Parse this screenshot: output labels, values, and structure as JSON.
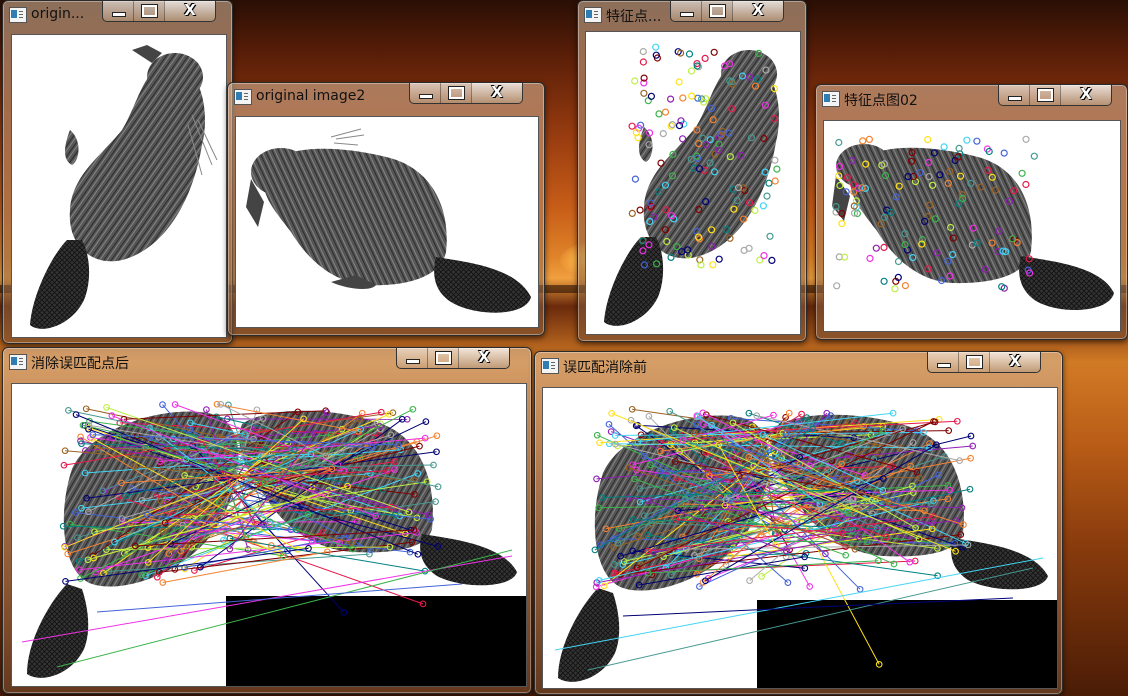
{
  "windows": {
    "w1": {
      "title": "origin..."
    },
    "w2": {
      "title": "original image2"
    },
    "w3": {
      "title": "特征点..."
    },
    "w4": {
      "title": "特征点图02"
    },
    "w5": {
      "title": "消除误匹配点后"
    },
    "w6": {
      "title": "误匹配消除前"
    }
  },
  "controls": {
    "minimize": "",
    "maximize": "",
    "close": "X"
  },
  "colors": {
    "match_lines": [
      "#e6194b",
      "#3cb44b",
      "#4363d8",
      "#f58231",
      "#911eb4",
      "#42d4f4",
      "#f032e6",
      "#bfef45",
      "#469990",
      "#9A6324",
      "#800000",
      "#000075",
      "#a9a9a9",
      "#ffe119",
      "#008080"
    ]
  }
}
